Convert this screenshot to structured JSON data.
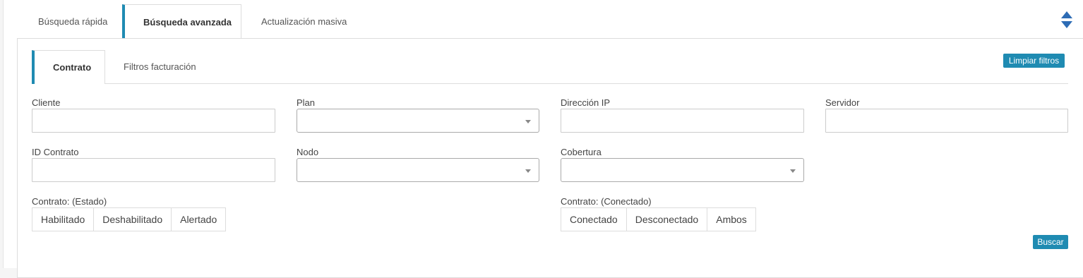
{
  "top_tabs": [
    {
      "label": "Búsqueda rápida"
    },
    {
      "label": "Búsqueda avanzada"
    },
    {
      "label": "Actualización masiva"
    }
  ],
  "sub_tabs": [
    {
      "label": "Contrato"
    },
    {
      "label": "Filtros facturación"
    }
  ],
  "buttons": {
    "clear_filters": "Limpiar filtros",
    "search": "Buscar"
  },
  "fields": {
    "cliente": {
      "label": "Cliente",
      "value": ""
    },
    "plan": {
      "label": "Plan",
      "value": ""
    },
    "direccion_ip": {
      "label": "Dirección IP",
      "value": ""
    },
    "servidor": {
      "label": "Servidor",
      "value": ""
    },
    "id_contrato": {
      "label": "ID Contrato",
      "value": ""
    },
    "nodo": {
      "label": "Nodo",
      "value": ""
    },
    "cobertura": {
      "label": "Cobertura",
      "value": ""
    }
  },
  "estado": {
    "label": "Contrato: (Estado)",
    "options": [
      "Habilitado",
      "Deshabilitado",
      "Alertado"
    ]
  },
  "conectado": {
    "label": "Contrato: (Conectado)",
    "options": [
      "Conectado",
      "Desconectado",
      "Ambos"
    ]
  },
  "colors": {
    "accent": "#1f8bb2",
    "sort_icon": "#2d6cb5"
  },
  "icons": {
    "sort": "sort-updown-icon",
    "caret": "chevron-down-icon"
  }
}
